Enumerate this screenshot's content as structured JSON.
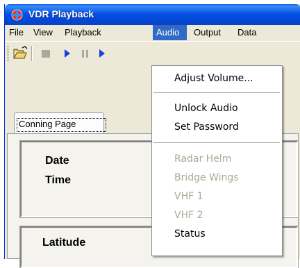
{
  "window": {
    "title": "VDR Playback"
  },
  "menubar": {
    "items": [
      "File",
      "View",
      "Playback",
      "Audio",
      "Output",
      "Data"
    ]
  },
  "tabs": [
    {
      "label": "Conning Page"
    }
  ],
  "fields": {
    "date": "Date",
    "time": "Time",
    "latitude": "Latitude"
  },
  "audio_menu": {
    "adjust_volume": "Adjust Volume...",
    "unlock_audio": "Unlock Audio",
    "set_password": "Set Password",
    "radar_helm": "Radar Helm",
    "bridge_wings": "Bridge Wings",
    "vhf1": "VHF 1",
    "vhf2": "VHF 2",
    "status": "Status"
  },
  "colors": {
    "menu_highlight": "#316ac5",
    "titlebar": "#0553e3",
    "disabled_text": "#aca899"
  },
  "icons": [
    "app-icon",
    "open-folder-icon",
    "stop-icon",
    "play-icon",
    "pause-icon",
    "play-icon"
  ]
}
